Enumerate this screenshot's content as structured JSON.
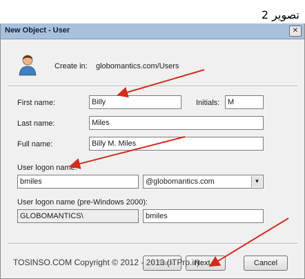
{
  "caption": "تصوير 2",
  "window": {
    "title": "New Object - User",
    "close_glyph": "✕"
  },
  "create_in": {
    "label": "Create in:",
    "path": "globomantics.com/Users"
  },
  "fields": {
    "first_name": {
      "label": "First name:",
      "value": "Billy"
    },
    "initials": {
      "label": "Initials:",
      "value": "M"
    },
    "last_name": {
      "label": "Last name:",
      "value": "Miles"
    },
    "full_name": {
      "label": "Full name:",
      "value": "Billy M. Miles"
    },
    "logon_name": {
      "label": "User logon name:",
      "value": "bmiles",
      "domain": "@globomantics.com"
    },
    "pre2000": {
      "label": "User logon name (pre-Windows 2000):",
      "prefix": "GLOBOMANTICS\\",
      "value": "bmiles"
    }
  },
  "buttons": {
    "back": "< Back",
    "next": "Next >",
    "cancel": "Cancel"
  },
  "watermark": "TOSINSO.COM  Copyright © 2012 - 2013 (ITPro.ir)",
  "colors": {
    "arrow": "#d42a1c",
    "titlebar": "#a9c0dd"
  }
}
